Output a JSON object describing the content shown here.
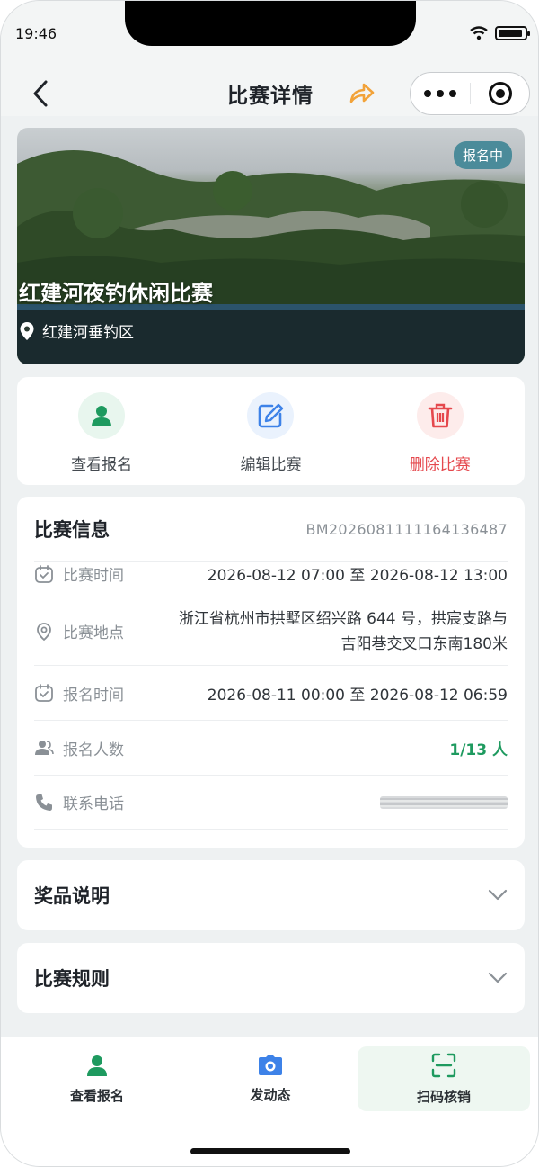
{
  "status_bar": {
    "time": "19:46"
  },
  "header": {
    "title": "比赛详情"
  },
  "hero": {
    "badge": "报名中",
    "title": "红建河夜钓休闲比赛",
    "location": "红建河垂钓区"
  },
  "actions": [
    {
      "label": "查看报名",
      "icon": "person-icon",
      "color": "#1e9a5f",
      "bg": "#e8f6ee"
    },
    {
      "label": "编辑比赛",
      "icon": "edit-icon",
      "color": "#3d82e8",
      "bg": "#eaf2fd"
    },
    {
      "label": "删除比赛",
      "icon": "trash-icon",
      "color": "#e5484d",
      "bg": "#fdeceb"
    }
  ],
  "info": {
    "title": "比赛信息",
    "code": "BM2026081111164136487",
    "rows": [
      {
        "label": "比赛时间",
        "icon": "calendar-icon",
        "value": "2026-08-12 07:00 至 2026-08-12 13:00"
      },
      {
        "label": "比赛地点",
        "icon": "location-icon",
        "value": "浙江省杭州市拱墅区绍兴路 644 号，拱宸支路与吉阳巷交叉口东南180米"
      },
      {
        "label": "报名时间",
        "icon": "calendar-icon",
        "value": "2026-08-11 00:00 至 2026-08-12 06:59"
      },
      {
        "label": "报名人数",
        "icon": "people-icon",
        "value": "1/13 人"
      },
      {
        "label": "联系电话",
        "icon": "phone-icon",
        "value": ""
      }
    ]
  },
  "sections": [
    {
      "title": "奖品说明"
    },
    {
      "title": "比赛规则"
    }
  ],
  "tabbar": [
    {
      "label": "查看报名",
      "icon": "person-icon"
    },
    {
      "label": "发动态",
      "icon": "camera-icon"
    },
    {
      "label": "扫码核销",
      "icon": "scan-icon"
    }
  ],
  "colors": {
    "accent": "#1e9a5f",
    "danger": "#e5484d",
    "share": "#f2a33a"
  }
}
